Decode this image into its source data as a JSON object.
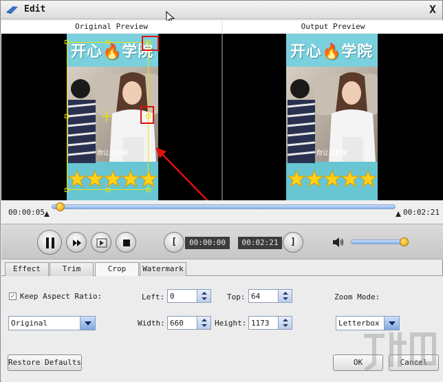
{
  "window": {
    "title": "Edit",
    "close_label": "X"
  },
  "preview": {
    "original_label": "Original Preview",
    "output_label": "Output Preview",
    "video_banner": "开心🔥学院",
    "video_subtitle": "你让让我嘛"
  },
  "timeline": {
    "current_time": "00:00:05",
    "end_time": "00:02:21",
    "position_fraction": 0.03
  },
  "controls": {
    "clip_start": "00:00:00",
    "clip_end": "00:02:21",
    "start_bracket": "[",
    "end_bracket": "]",
    "volume_fraction": 0.98
  },
  "tabs": [
    {
      "label": "Effect",
      "active": false
    },
    {
      "label": "Trim",
      "active": false
    },
    {
      "label": "Crop",
      "active": true
    },
    {
      "label": "Watermark",
      "active": false
    }
  ],
  "crop": {
    "keep_aspect_label": "Keep Aspect Ratio:",
    "keep_aspect_checked": true,
    "left_label": "Left:",
    "left_value": "0",
    "top_label": "Top:",
    "top_value": "64",
    "width_label": "Width:",
    "width_value": "660",
    "height_label": "Height:",
    "height_value": "1173",
    "zoom_mode_label": "Zoom Mode:",
    "zoom_mode_value": "Letterbox",
    "aspect_select_value": "Original"
  },
  "buttons": {
    "restore": "Restore Defaults",
    "ok": "OK",
    "cancel": "Cancel"
  },
  "colors": {
    "accent_blue": "#7faee8",
    "crop_yellow": "#e6e600",
    "annotation_red": "#e01010",
    "slider_thumb": "#e0a000"
  }
}
